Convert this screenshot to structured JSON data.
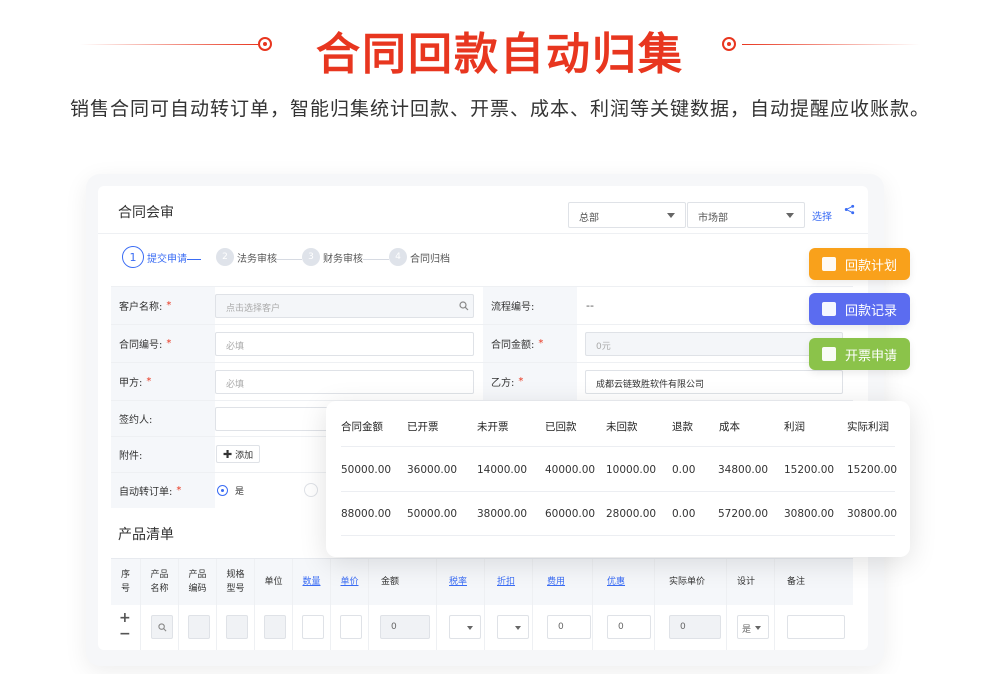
{
  "hero": {
    "title": "合同回款自动归集",
    "subtitle": "销售合同可自动转订单，智能归集统计回款、开票、成本、利润等关键数据，自动提醒应收账款。"
  },
  "card": {
    "title": "合同会审",
    "filter1": "总部",
    "filter2": "市场部",
    "select_link": "选择"
  },
  "steps": [
    {
      "num": "1",
      "label": "提交申请"
    },
    {
      "num": "2",
      "label": "法务审核"
    },
    {
      "num": "3",
      "label": "财务审核"
    },
    {
      "num": "4",
      "label": "合同归档"
    }
  ],
  "form": {
    "customer_label": "客户名称:",
    "customer_placeholder": "点击选择客户",
    "flow_no_label": "流程编号:",
    "flow_no_value": "--",
    "contract_no_label": "合同编号:",
    "contract_no_placeholder": "必填",
    "amount_label": "合同金额:",
    "amount_value": "0元",
    "party_a_label": "甲方:",
    "party_a_placeholder": "必填",
    "party_b_label": "乙方:",
    "party_b_value": "成都云链致胜软件有限公司",
    "signer_label": "签约人:",
    "attach_label": "附件:",
    "attach_button": "添加",
    "auto_order_label": "自动转订单:",
    "auto_order_yes": "是"
  },
  "product": {
    "title": "产品清单",
    "headers": [
      "序号",
      "产品名称",
      "产品编码",
      "规格型号",
      "单位",
      "数量",
      "单价",
      "金额",
      "税率",
      "折扣",
      "费用",
      "优惠",
      "实际单价",
      "设计",
      "备注"
    ],
    "row": {
      "amount": "0",
      "fee": "0",
      "discount_amt": "0",
      "actual_price": "0",
      "design": "是"
    }
  },
  "side_buttons": [
    {
      "label": "回款计划",
      "color": "#f9a11b",
      "icon": "plan-icon"
    },
    {
      "label": "回款记录",
      "color": "#5b6cf0",
      "icon": "record-icon"
    },
    {
      "label": "开票申请",
      "color": "#8bc34a",
      "icon": "invoice-icon"
    }
  ],
  "stats": {
    "headers": [
      "合同金额",
      "已开票",
      "未开票",
      "已回款",
      "未回款",
      "退款",
      "成本",
      "利润",
      "实际利润"
    ],
    "rows": [
      [
        "50000.00",
        "36000.00",
        "14000.00",
        "40000.00",
        "10000.00",
        "0.00",
        "34800.00",
        "15200.00",
        "15200.00"
      ],
      [
        "88000.00",
        "50000.00",
        "38000.00",
        "60000.00",
        "28000.00",
        "0.00",
        "57200.00",
        "30800.00",
        "30800.00"
      ]
    ]
  }
}
